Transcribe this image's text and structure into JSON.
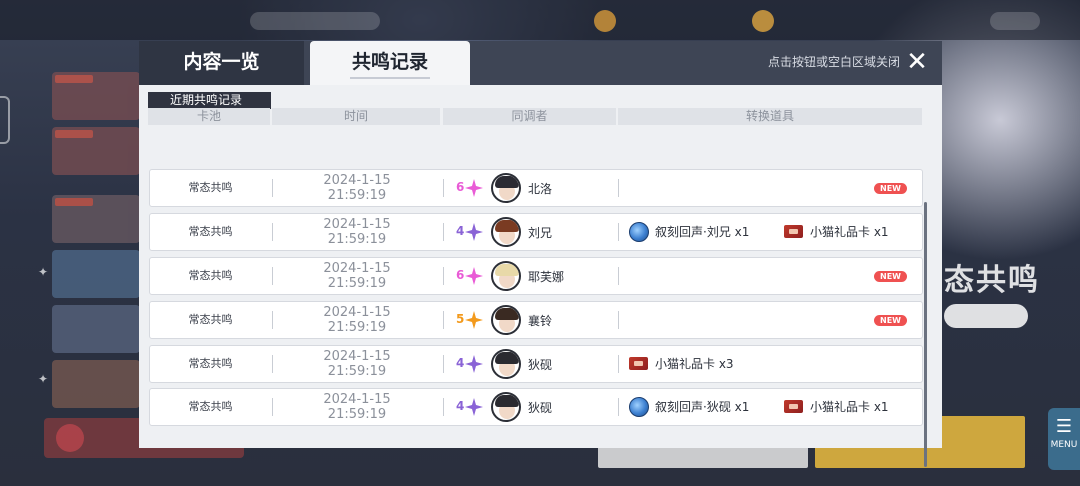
{
  "tabs": [
    {
      "label": "内容一览",
      "active": false
    },
    {
      "label": "共鸣记录",
      "active": true
    }
  ],
  "close_hint": "点击按钮或空白区域关闭",
  "close_icon": "close-icon",
  "section_label": "近期共鸣记录",
  "columns": [
    "卡池",
    "时间",
    "同调者",
    "转换道具"
  ],
  "colors": {
    "six_star": "#e95bd6",
    "five_star": "#f39a1c",
    "four_star": "#8a63d6",
    "new_badge": "#ef5151"
  },
  "rows": [
    {
      "pool": "常态共鸣",
      "date": "2024-1-15",
      "time": "21:59:19",
      "stars": "6",
      "name": "北洛",
      "new": "NEW",
      "items": []
    },
    {
      "pool": "常态共鸣",
      "date": "2024-1-15",
      "time": "21:59:19",
      "stars": "4",
      "name": "刘兄",
      "new": null,
      "items": [
        {
          "icon": "echo",
          "label": "叙刻回声·刘兄 x1"
        },
        {
          "icon": "gift-card",
          "label": "小猫礼品卡 x1"
        }
      ]
    },
    {
      "pool": "常态共鸣",
      "date": "2024-1-15",
      "time": "21:59:19",
      "stars": "6",
      "name": "耶芙娜",
      "new": "NEW",
      "items": []
    },
    {
      "pool": "常态共鸣",
      "date": "2024-1-15",
      "time": "21:59:19",
      "stars": "5",
      "name": "襄铃",
      "new": "NEW",
      "items": []
    },
    {
      "pool": "常态共鸣",
      "date": "2024-1-15",
      "time": "21:59:19",
      "stars": "4",
      "name": "狄砚",
      "new": null,
      "items": [
        {
          "icon": "gift-card",
          "label": "小猫礼品卡 x3"
        }
      ]
    },
    {
      "pool": "常态共鸣",
      "date": "2024-1-15",
      "time": "21:59:19",
      "stars": "4",
      "name": "狄砚",
      "new": null,
      "items": [
        {
          "icon": "echo",
          "label": "叙刻回声·狄砚 x1"
        },
        {
          "icon": "gift-card",
          "label": "小猫礼品卡 x1"
        }
      ]
    }
  ],
  "background": {
    "title": "态共鸣",
    "menu_label": "MENU"
  }
}
